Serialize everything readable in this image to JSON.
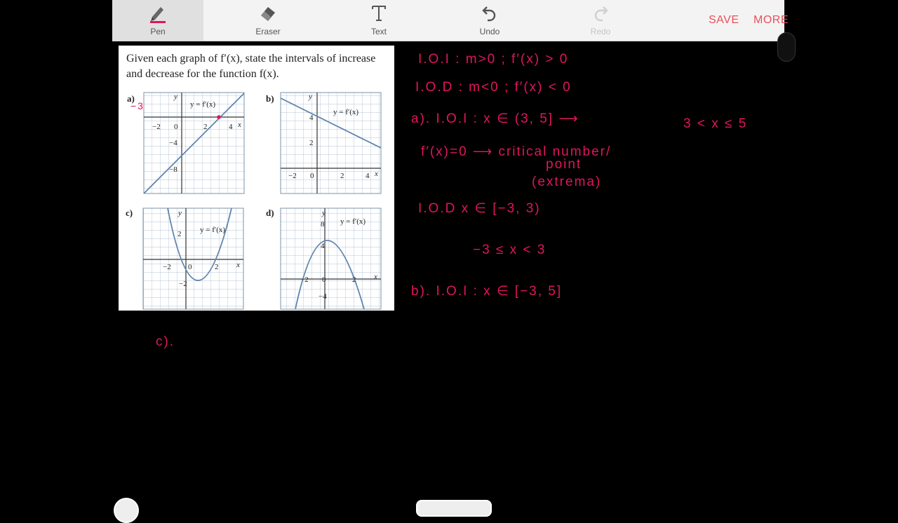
{
  "toolbar": {
    "tools": [
      {
        "label": "Pen",
        "icon": "pen-icon",
        "active": true
      },
      {
        "label": "Eraser",
        "icon": "eraser-icon"
      },
      {
        "label": "Text",
        "icon": "text-icon"
      },
      {
        "label": "Undo",
        "icon": "undo-icon"
      },
      {
        "label": "Redo",
        "icon": "redo-icon",
        "disabled": true
      }
    ],
    "save_label": "SAVE",
    "more_label": "MORE",
    "accent_color": "#e8505b",
    "pen_color": "#e0155f"
  },
  "worksheet": {
    "question": "Given each graph of f′(x), state the intervals of increase and decrease for the function f(x).",
    "graphs": [
      {
        "part": "a)",
        "curve_label": "y = f′(x)",
        "ticks": [
          "−2",
          "0",
          "2",
          "4",
          "−4",
          "−8"
        ],
        "axis_x": "x",
        "axis_y": "y"
      },
      {
        "part": "b)",
        "curve_label": "y = f′(x)",
        "ticks": [
          "4",
          "2",
          "−2",
          "0",
          "2",
          "4"
        ],
        "axis_x": "x",
        "axis_y": "y"
      },
      {
        "part": "c)",
        "curve_label": "y = f′(x)",
        "ticks": [
          "2",
          "−2",
          "0",
          "2",
          "−2"
        ],
        "axis_x": "x",
        "axis_y": "y"
      },
      {
        "part": "d)",
        "curve_label": "y = f′(x)",
        "ticks": [
          "8",
          "4",
          "−2",
          "0",
          "2",
          "−4"
        ],
        "axis_x": "x",
        "axis_y": "y"
      }
    ]
  },
  "notes": {
    "lines": [
      "I.O.I :   m>0   ;   f′(x) > 0",
      "I.O.D :   m<0   ;   f′(x) < 0",
      "a). I.O.I :   x ∈ (3, 5] ⟶",
      "3 < x ≤ 5",
      "f′(x)=0  ⟶  critical number/",
      "point",
      "(extrema)",
      "I.O.D    x ∈ [−3, 3)",
      "−3 ≤ x < 3",
      "b). I.O.I :   x ∈ [−3, 5]",
      "c)."
    ],
    "margin_mark": "−3"
  }
}
